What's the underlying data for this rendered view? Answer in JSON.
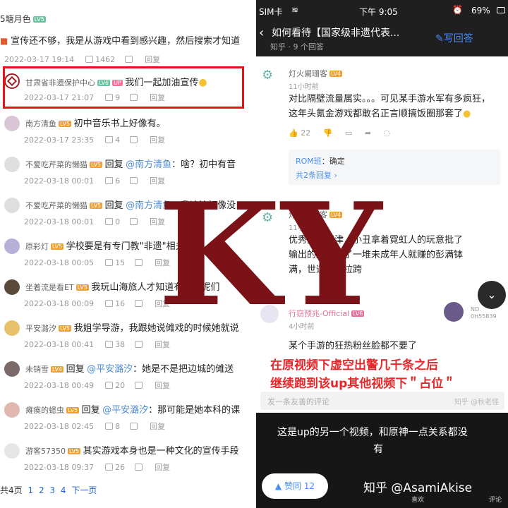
{
  "left": {
    "top_name": "5塘月色",
    "top_lv": "LV5",
    "top_text": "宣传还不够，我是从游戏中看到感兴趣，然后搜索才知道",
    "top_date": "2022-03-17 19:14",
    "top_likes": "1462",
    "reply_label": "回复",
    "comments": [
      {
        "name": "甘肃省非遗保护中心",
        "lv": "LV6",
        "up": "UP",
        "text": "我们一起加油宣传",
        "date": "2022-03-17 21:07",
        "likes": "9"
      },
      {
        "name": "南方清鱼",
        "lv": "LV5",
        "text": "初中音乐书上好像有。",
        "date": "2022-03-17 23:35",
        "likes": "4"
      },
      {
        "name": "不爱吃芹菜的懒猫",
        "lv": "LV5",
        "prefix": "回复",
        "mention": "@南方清鱼",
        "text": "：啥？初中有音",
        "date": "2022-03-18 00:01",
        "likes": "6"
      },
      {
        "name": "不爱吃芹菜的懒猫",
        "lv": "LV5",
        "prefix": "回复",
        "mention": "@南方清鱼",
        "text": "：我这边好像没",
        "date": "2022-03-18 00:01",
        "likes": "0"
      },
      {
        "name": "原彩灯",
        "lv": "LV5",
        "text": "学校要是有专门教\"非遗\"相关的",
        "date": "2022-03-18 00:05",
        "likes": "15"
      },
      {
        "name": "坐着流是看ET",
        "lv": "LV5",
        "text": "我玩山海旅人才知道有傩戏呢们",
        "date": "2022-03-18 00:09",
        "likes": "16"
      },
      {
        "name": "平安潞汐",
        "lv": "LV5",
        "text": "我姐学导游，我跟她说傩戏的时候她就说",
        "date": "2022-03-18 00:41",
        "likes": "38"
      },
      {
        "name": "未销雪",
        "lv": "LV4",
        "prefix": "回复",
        "mention": "@平安潞汐",
        "text": "：她是不是把边城的傩送",
        "date": "2022-03-18 00:49",
        "likes": "20"
      },
      {
        "name": "瘫痪的蟋虫",
        "lv": "LV5",
        "prefix": "回复",
        "mention": "@平安潞汐",
        "text": "：那可能是她本科的课",
        "date": "2022-03-18 02:45",
        "likes": "8"
      },
      {
        "name": "游客57350",
        "lv": "LV5",
        "text": "其实游戏本身也是一种文化的宣传手段",
        "date": "2022-03-18 09:37",
        "likes": "26"
      }
    ],
    "pager_prefix": "共4页",
    "pages": [
      "1",
      "2",
      "3",
      "4"
    ],
    "next": "下一页"
  },
  "right": {
    "status_carrier": "SIM卡",
    "status_time": "下午 9:05",
    "status_battery": "69%",
    "nav_title": "如何看待【国家级非遗代表...",
    "nav_sub": "知乎 · 9 个回答",
    "nav_write": "写回答",
    "c1_name": "灯火阑珊客",
    "c1_lv": "LV4",
    "c1_time": "11小时前",
    "c1_lines": [
      "对比隔壁流量属实。。。可见某手游水军有多疯狂，",
      "这年头氪金游戏都敢名正言顺搞饭圈那套了"
    ],
    "c1_likes": "22",
    "sub_author": "ROM班",
    "sub_text": "：确定",
    "sub_more": "共2条回复",
    "c2_name": "灯火阑珊客",
    "c2_lv": "LV4",
    "c2_time": "11小时前",
    "c2_lines": [
      "优秀无人问津，小丑拿着霓虹人的玩意批了",
      "输出的皮洗脑了一堆未成年人就赚的彭满钵",
      "满，世道属实拉跨"
    ],
    "c3_name": "行窃预兆-Official",
    "c3_lv": "LV6",
    "c3_time": "4小时前",
    "c3_right_name": "ND.",
    "c3_right_sub": "0H55839",
    "c3_text": "某个手游的狂热粉丝脸都不要了",
    "red_lines": [
      "在原视频下虚空出警几千条之后",
      "继续跑到该up其他视频下＂占位＂"
    ],
    "watermark_small": "知乎 @秋老怪",
    "input_placeholder": "发一条友善的评论",
    "overlay_lines": [
      "这是up的另一个视频，和原神一点关系都没",
      "有"
    ],
    "agree_label": "赞同 12",
    "brand": "知乎 @AsamiAkise",
    "icons_labels": [
      "喜欢",
      "评论"
    ]
  },
  "ky": "KY"
}
